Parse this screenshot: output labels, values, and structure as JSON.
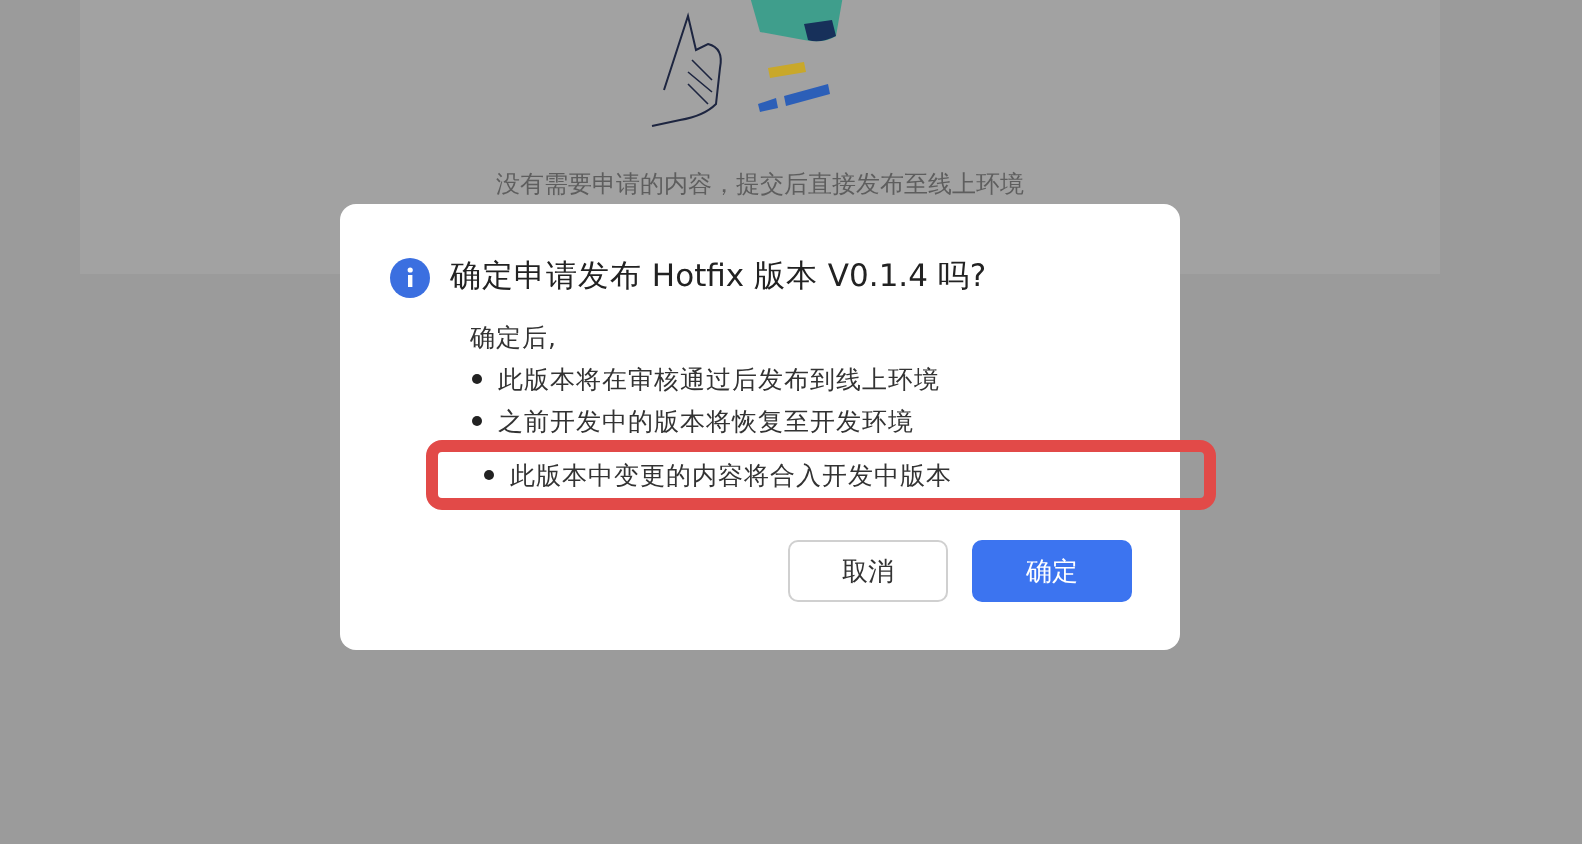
{
  "background": {
    "empty_message": "没有需要申请的内容，提交后直接发布至线上环境"
  },
  "dialog": {
    "title": "确定申请发布 Hotfix 版本 V0.1.4 吗?",
    "intro": "确定后,",
    "items": [
      {
        "text": "此版本将在审核通过后发布到线上环境",
        "highlighted": false
      },
      {
        "text": "之前开发中的版本将恢复至开发环境",
        "highlighted": false
      },
      {
        "text": "此版本中变更的内容将合入开发中版本",
        "highlighted": true
      }
    ],
    "buttons": [
      {
        "label": "取消",
        "kind": "secondary"
      },
      {
        "label": "确定",
        "kind": "primary"
      }
    ]
  }
}
